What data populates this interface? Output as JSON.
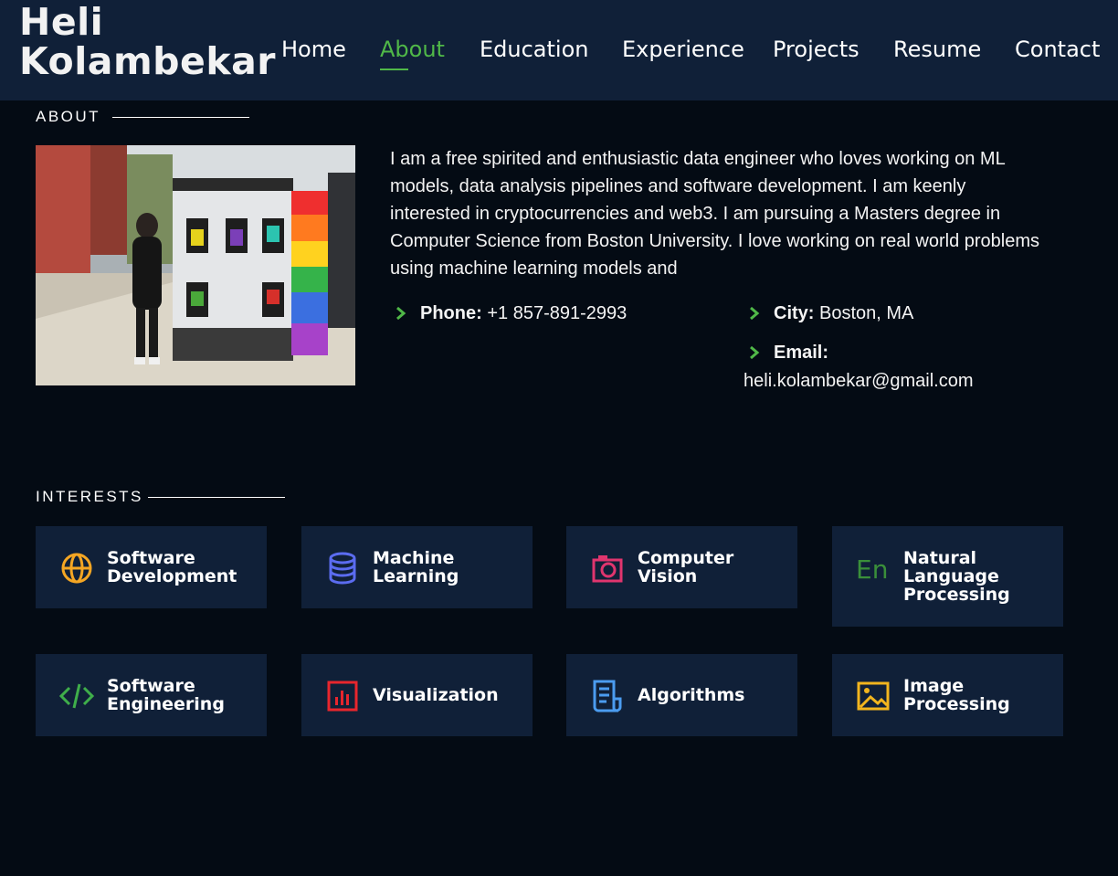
{
  "header": {
    "logo_line1": "Heli",
    "logo_line2": "Kolambekar",
    "nav": [
      {
        "label": "Home"
      },
      {
        "label": "About"
      },
      {
        "label": "Education"
      },
      {
        "label": "Experience"
      },
      {
        "label": "Projects"
      },
      {
        "label": "Resume"
      },
      {
        "label": "Contact"
      }
    ],
    "active_nav": "About"
  },
  "about": {
    "section_title": "ABOUT",
    "bio": "I am a free spirited and enthusiastic data engineer who loves working on ML models, data analysis pipelines and software development. I am keenly interested in cryptocurrencies and web3. I am pursuing a Masters degree in Computer Science from Boston University. I love working on real world problems using machine learning models and",
    "phone_label": "Phone:",
    "phone_value": "+1 857-891-2993",
    "city_label": "City:",
    "city_value": "Boston, MA",
    "email_label": "Email:",
    "email_value": "heli.kolambekar@gmail.com"
  },
  "interests": {
    "section_title": "INTERESTS",
    "items": [
      {
        "label": "Software Development",
        "icon": "globe-icon",
        "color": "#f5a623"
      },
      {
        "label": "Machine Learning",
        "icon": "database-icon",
        "color": "#5b6cf0"
      },
      {
        "label": "Computer Vision",
        "icon": "camera-icon",
        "color": "#e0356e"
      },
      {
        "label": "Natural Language Processing",
        "icon": "language-en-icon",
        "color": "#3a8f3a"
      },
      {
        "label": "Software Engineering",
        "icon": "code-icon",
        "color": "#3fae4a"
      },
      {
        "label": "Visualization",
        "icon": "bar-chart-icon",
        "color": "#e8262d"
      },
      {
        "label": "Algorithms",
        "icon": "document-icon",
        "color": "#4b9cf0"
      },
      {
        "label": "Image Processing",
        "icon": "image-icon",
        "color": "#f2b51e"
      }
    ]
  },
  "colors": {
    "background": "#040b14",
    "header_bg": "#102038",
    "card_bg": "#102038",
    "accent_green": "#50b848"
  }
}
